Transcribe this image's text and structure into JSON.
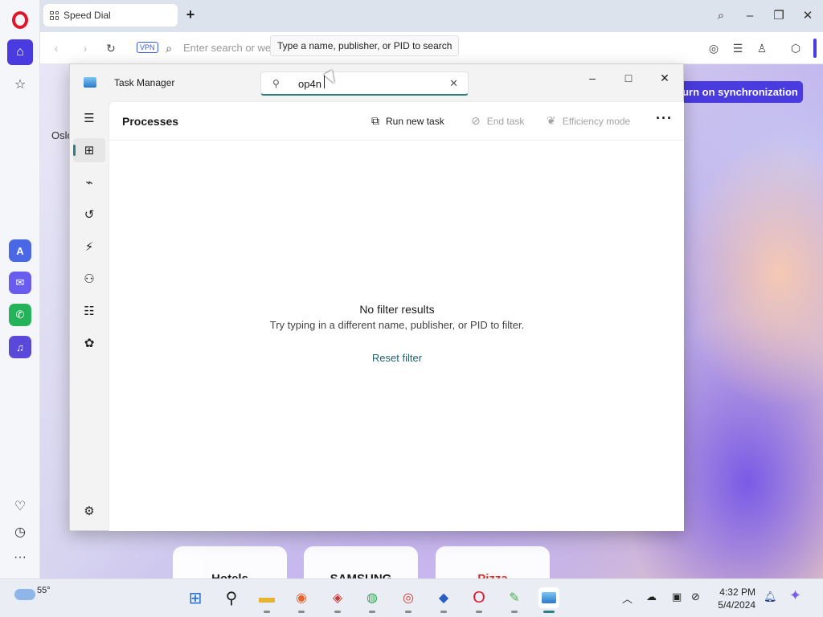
{
  "browser": {
    "tab_title": "Speed Dial",
    "address_placeholder": "Enter search or web",
    "vpn_label": "VPN",
    "sync_button": "Turn on synchronization",
    "weather_city": "Oslo",
    "speed_dials": [
      "Hotels",
      "SAMSUNG",
      "Pizza"
    ]
  },
  "tooltip": "Type a name, publisher, or PID to search",
  "task_manager": {
    "title": "Task Manager",
    "search_value": "op4n",
    "page_title": "Processes",
    "toolbar": {
      "run_new_task": "Run new task",
      "end_task": "End task",
      "efficiency_mode": "Efficiency mode",
      "more": "···"
    },
    "empty": {
      "title": "No filter results",
      "hint": "Try typing in a different name, publisher, or PID to filter.",
      "reset": "Reset filter"
    }
  },
  "taskbar": {
    "temperature": "55°",
    "time": "4:32 PM",
    "date": "5/4/2024"
  },
  "colors": {
    "opera_accent": "#4a3be0",
    "tm_accent": "#2a7f7f",
    "opera_red": "#e0162b"
  }
}
